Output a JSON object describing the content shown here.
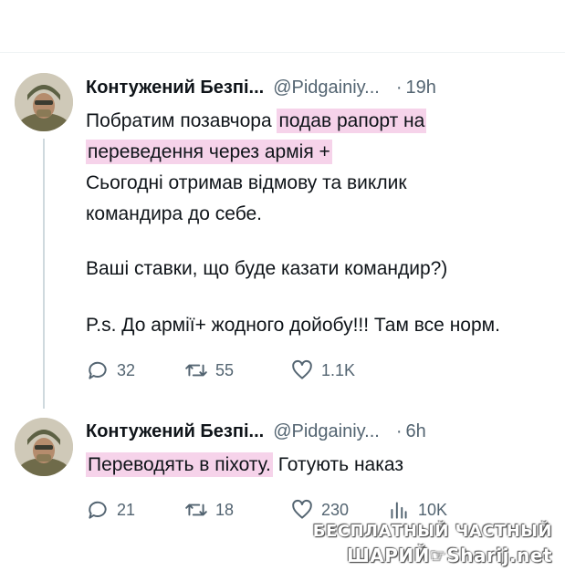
{
  "tweets": [
    {
      "author_name": "Контужений Безпі...",
      "handle": "@Pidgainiy...",
      "separator": "·",
      "time": "19h",
      "lines": [
        {
          "plain": "Побратим позавчора ",
          "highlight": "подав рапорт на"
        },
        {
          "plain": "",
          "highlight": "переведення через армія +"
        },
        {
          "plain": "Сьогодні отримав відмову та виклик",
          "highlight": ""
        },
        {
          "plain": "командира до себе.",
          "highlight": ""
        },
        {
          "plain": "Ваші ставки, що буде казати командир?)",
          "highlight": ""
        },
        {
          "plain": "P.s. До армії+ жодного дойобу!!! Там все норм.",
          "highlight": ""
        }
      ],
      "replies": "32",
      "retweets": "55",
      "likes": "1.1K"
    },
    {
      "author_name": "Контужений Безпі...",
      "handle": "@Pidgainiy...",
      "separator": "·",
      "time": "6h",
      "line_highlight": "Переводять в піхоту.",
      "line_plain": " Готують наказ",
      "replies": "21",
      "retweets": "18",
      "likes": "230",
      "views": "10K"
    }
  ],
  "watermark": {
    "line1": "БЕСПЛАТНЫЙ ЧАСТНЫЙ",
    "line2": "ШАРИЙ☞Sharij.net"
  },
  "icons": {
    "reply": "reply-icon",
    "retweet": "retweet-icon",
    "like": "heart-icon",
    "views": "views-icon"
  },
  "colors": {
    "highlight": "#f6d3ea",
    "secondary_text": "#536471",
    "thread_line": "#cfd9de"
  }
}
